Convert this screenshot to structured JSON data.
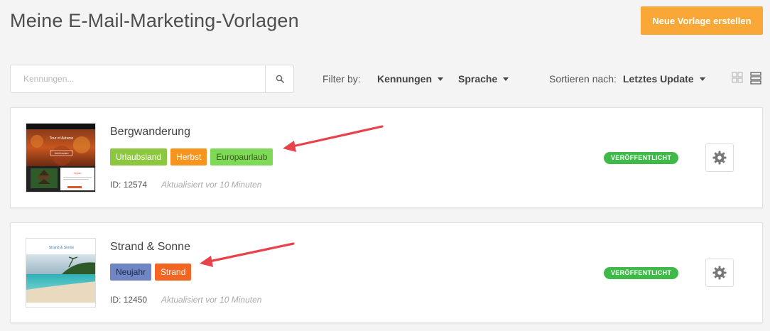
{
  "page": {
    "title": "Meine E-Mail-Marketing-Vorlagen",
    "new_template_label": "Neue Vorlage erstellen"
  },
  "toolbar": {
    "search_placeholder": "Kennungen...",
    "filter_label": "Filter by:",
    "filter_tags_label": "Kennungen",
    "filter_language_label": "Sprache",
    "sort_label": "Sortieren nach:",
    "sort_value": "Letztes Update"
  },
  "colors": {
    "accent": "#f9a838",
    "status_green": "#3fba49",
    "arrow_red": "#e8424a"
  },
  "templates": [
    {
      "name": "Bergwanderung",
      "tags": [
        {
          "label": "Urlaubsland",
          "color": "#8dc63f"
        },
        {
          "label": "Herbst",
          "color": "#f7941d"
        },
        {
          "label": "Europaurlaub",
          "color": "#7ed957"
        }
      ],
      "id_label": "ID: 12574",
      "updated": "Aktualisiert vor 10 Minuten",
      "status": "VERÖFFENTLICHT",
      "thumbnail_title": "Tour of Autumn",
      "thumbnail_subtitle": "Jetzt buchen",
      "thumbnail_caption": "Japan"
    },
    {
      "name": "Strand & Sonne",
      "tags": [
        {
          "label": "Neujahr",
          "color": "#6f85c4"
        },
        {
          "label": "Strand",
          "color": "#f26522"
        }
      ],
      "id_label": "ID: 12450",
      "updated": "Aktualisiert vor 10 Minuten",
      "status": "VERÖFFENTLICHT",
      "thumbnail_title": "Strand & Sonne"
    }
  ]
}
